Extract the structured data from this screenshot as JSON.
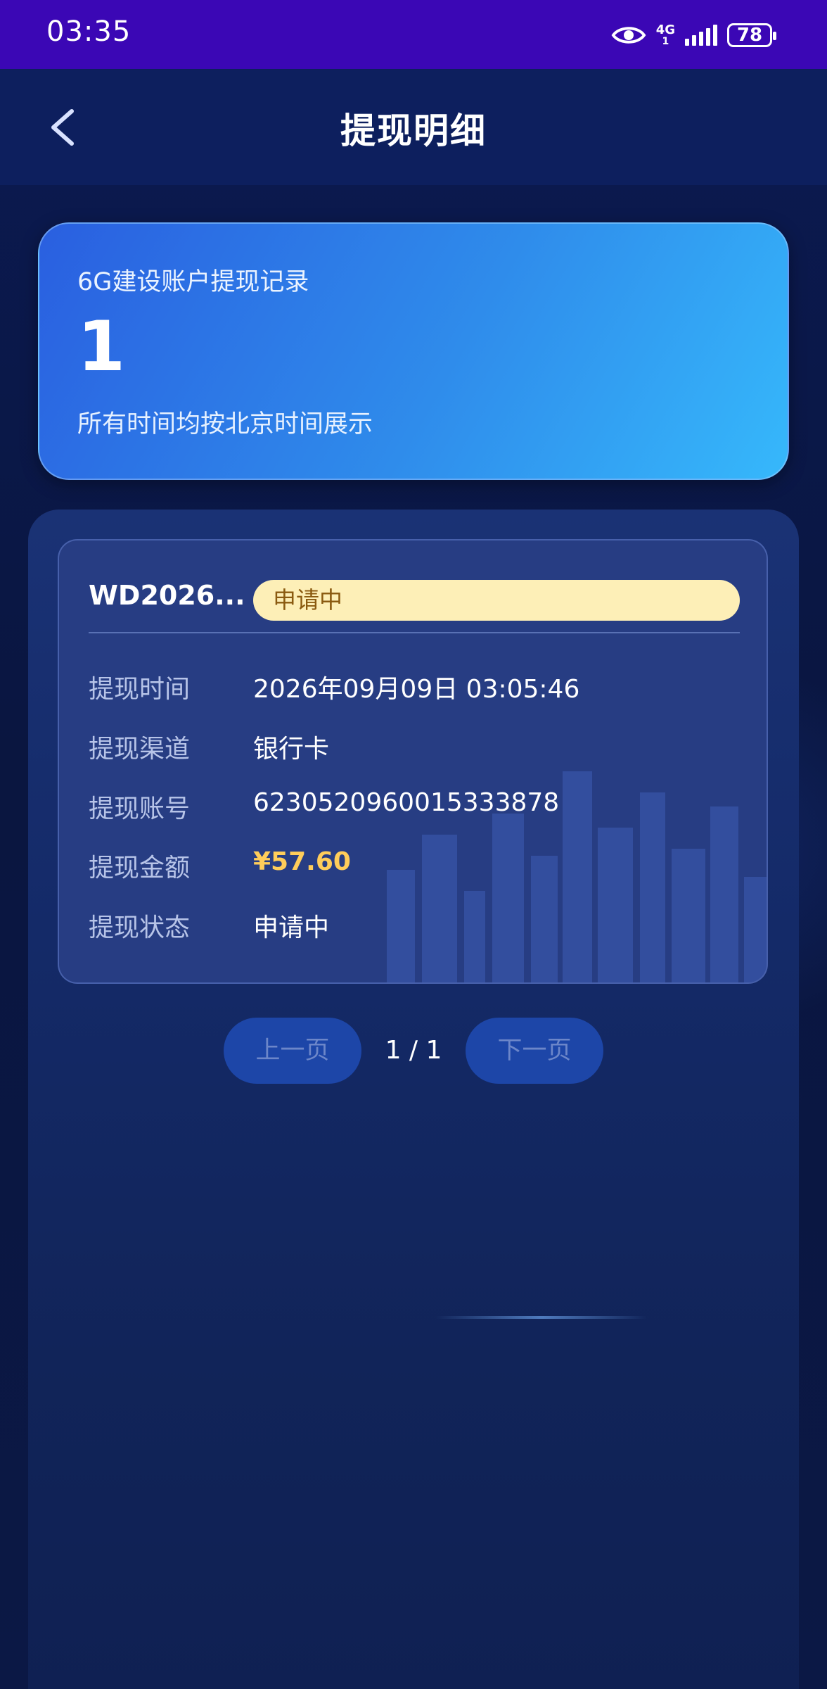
{
  "status_bar": {
    "time": "03:35",
    "network_label_top": "4G",
    "network_label_bottom": "1",
    "battery": "78"
  },
  "header": {
    "title": "提现明细",
    "back_icon": "chevron-left-icon"
  },
  "summary": {
    "label": "6G建设账户提现记录",
    "count": "1",
    "note": "所有时间均按北京时间展示"
  },
  "record": {
    "id": "WD2026...",
    "status_badge": "申请中",
    "rows": [
      {
        "label": "提现时间",
        "value": "2026年09月09日 03:05:46"
      },
      {
        "label": "提现渠道",
        "value": "银行卡"
      },
      {
        "label": "提现账号",
        "value": "6230520960015333878"
      },
      {
        "label": "提现金额",
        "value": "¥57.60"
      },
      {
        "label": "提现状态",
        "value": "申请中"
      }
    ]
  },
  "pagination": {
    "prev_label": "上一页",
    "indicator": "1 / 1",
    "next_label": "下一页"
  },
  "colors": {
    "status_bar": "#3b07b5",
    "summary_gradient_start": "#2a5fe0",
    "summary_gradient_end": "#36b8fb",
    "badge_bg": "#fdefb7",
    "amount": "#ffcd5a"
  }
}
